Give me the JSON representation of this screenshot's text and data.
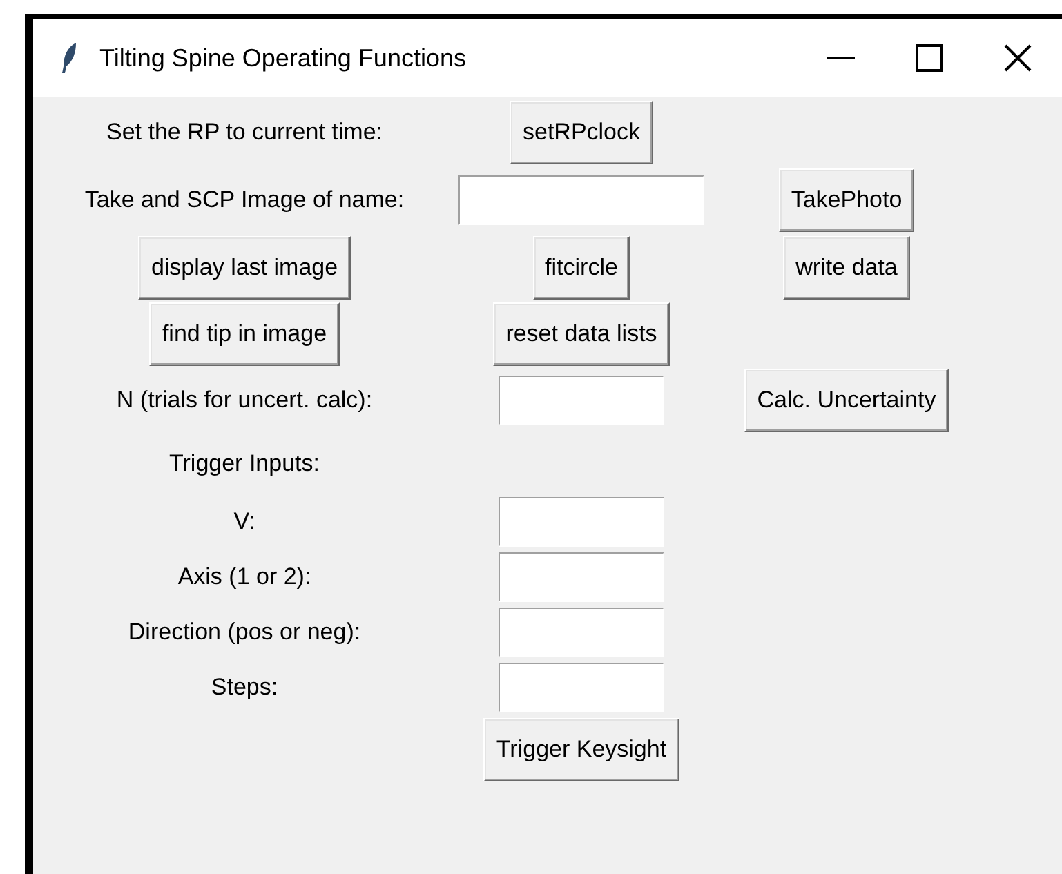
{
  "window": {
    "title": "Tilting Spine Operating Functions",
    "controls": [
      {
        "kind": "minimize"
      },
      {
        "kind": "maximize"
      },
      {
        "kind": "close"
      }
    ]
  },
  "rows": [
    {
      "cells": [
        {
          "kind": "label",
          "text": "Set the RP to current time:"
        },
        {
          "kind": "button",
          "text": "setRPclock"
        },
        {
          "kind": "blank"
        }
      ]
    },
    {
      "cells": [
        {
          "kind": "label",
          "text": "Take and SCP Image of name:"
        },
        {
          "kind": "wide_entry"
        },
        {
          "kind": "button",
          "text": "TakePhoto"
        }
      ]
    },
    {
      "cells": [
        {
          "kind": "button",
          "text": "display last image"
        },
        {
          "kind": "button",
          "text": "fitcircle"
        },
        {
          "kind": "button",
          "text": "write data"
        }
      ]
    },
    {
      "cells": [
        {
          "kind": "button",
          "text": "find tip in image"
        },
        {
          "kind": "button",
          "text": "reset data lists"
        },
        {
          "kind": "blank"
        }
      ]
    },
    {
      "cells": [
        {
          "kind": "label",
          "text": "N (trials for uncert. calc):"
        },
        {
          "kind": "entry"
        },
        {
          "kind": "button",
          "text": "Calc. Uncertainty"
        }
      ]
    },
    {
      "cells": [
        {
          "kind": "label",
          "text": "Trigger Inputs:"
        },
        {
          "kind": "blank"
        },
        {
          "kind": "blank"
        }
      ]
    },
    {
      "cells": [
        {
          "kind": "label",
          "text": "V:"
        },
        {
          "kind": "entry"
        },
        {
          "kind": "blank"
        }
      ]
    },
    {
      "cells": [
        {
          "kind": "label",
          "text": "Axis (1 or 2):"
        },
        {
          "kind": "entry"
        },
        {
          "kind": "blank"
        }
      ]
    },
    {
      "cells": [
        {
          "kind": "label",
          "text": "Direction (pos or neg):"
        },
        {
          "kind": "entry"
        },
        {
          "kind": "blank"
        }
      ]
    },
    {
      "cells": [
        {
          "kind": "label",
          "text": "Steps:"
        },
        {
          "kind": "entry"
        },
        {
          "kind": "blank"
        }
      ]
    },
    {
      "cells": [
        {
          "kind": "blank"
        },
        {
          "kind": "button",
          "text": "Trigger Keysight"
        },
        {
          "kind": "blank"
        }
      ]
    }
  ]
}
